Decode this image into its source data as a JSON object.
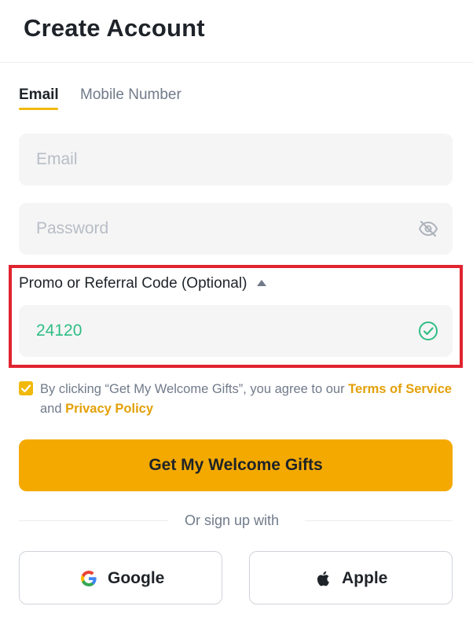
{
  "header": {
    "title": "Create Account"
  },
  "tabs": [
    {
      "label": "Email",
      "active": true
    },
    {
      "label": "Mobile Number",
      "active": false
    }
  ],
  "form": {
    "email_placeholder": "Email",
    "email_value": "",
    "password_placeholder": "Password",
    "password_value": "",
    "password_toggle_icon": "eye-off-icon",
    "promo_label": "Promo or Referral Code (Optional)",
    "promo_value": "24120",
    "promo_status_icon": "check-circle-icon"
  },
  "agreement": {
    "checked": true,
    "text_before": "By clicking “Get My Welcome Gifts”, you agree to our ",
    "terms_link": "Terms of Service",
    "text_and": " and ",
    "privacy_link": "Privacy Policy"
  },
  "cta": {
    "label": "Get My Welcome Gifts"
  },
  "divider": {
    "text": "Or sign up with"
  },
  "social": {
    "google_label": "Google",
    "apple_label": "Apple"
  },
  "colors": {
    "accent": "#f4a900",
    "link": "#e3a008",
    "success": "#2ebd85",
    "highlight_border": "#e0242f"
  }
}
